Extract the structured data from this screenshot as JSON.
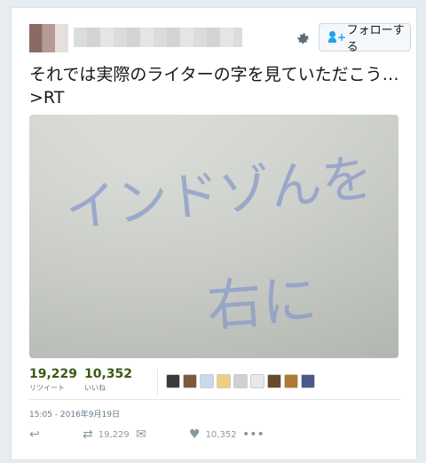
{
  "header": {
    "follow_label": "フォローする"
  },
  "tweet": {
    "text": "それでは実際のライターの字を見ていただこう…　>RT"
  },
  "photo": {
    "handwriting_line1": "インドゾんを",
    "handwriting_line2": "右に"
  },
  "stats": {
    "retweets_count": "19,229",
    "retweets_label": "リツイート",
    "likes_count": "10,352",
    "likes_label": "いいね"
  },
  "timestamp": "15:05 - 2016年9月19日",
  "actions": {
    "retweet_count": "19,229",
    "like_count": "10,352"
  },
  "icons": [
    "gear-icon",
    "follow-person-icon",
    "reply-icon",
    "retweet-icon",
    "dm-icon",
    "heart-icon",
    "more-icon"
  ],
  "colors": {
    "accent": "#1da1f2",
    "stat_number": "#3a5a14",
    "meta_text": "#657786",
    "background": "#e6ecf0"
  }
}
